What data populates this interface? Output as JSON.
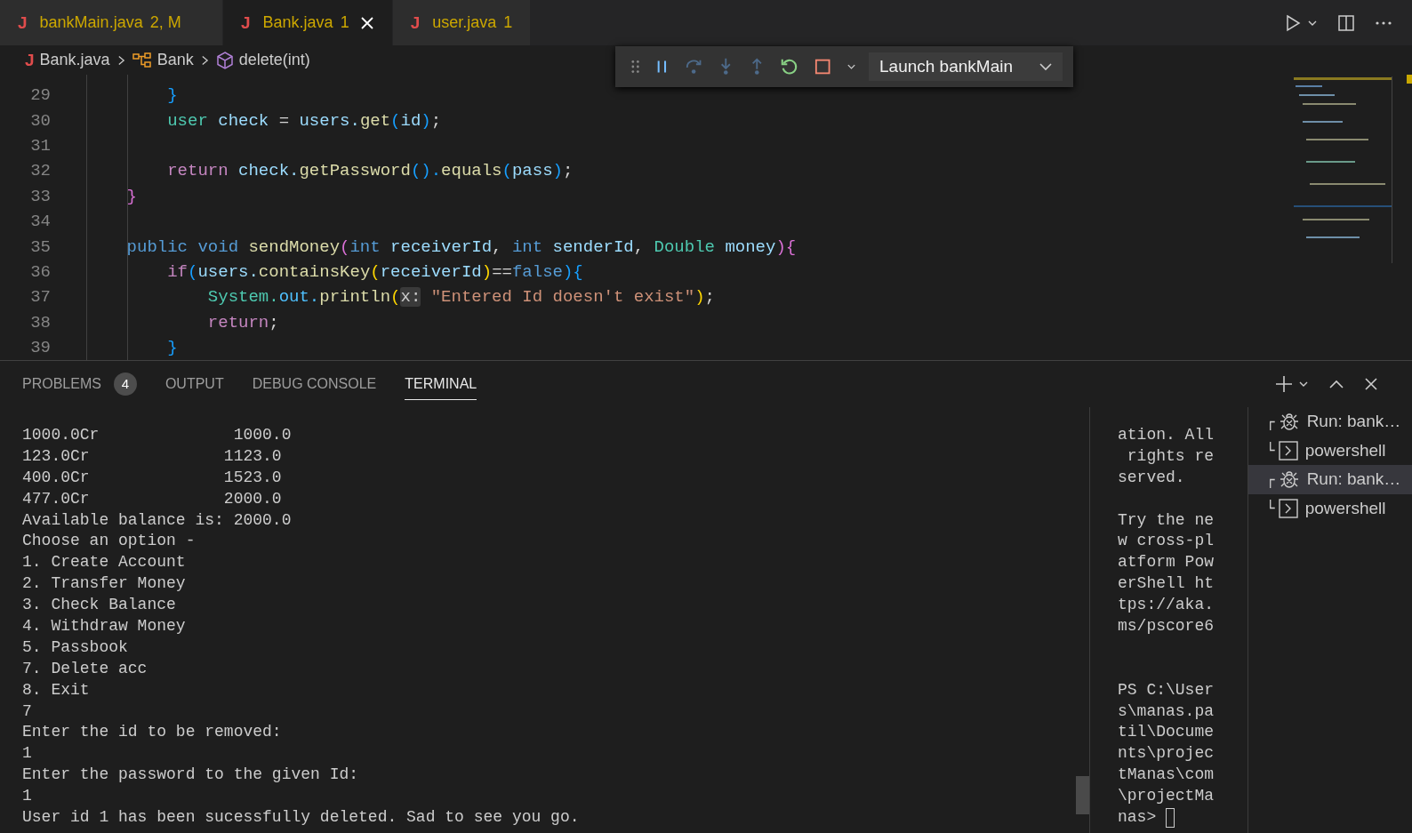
{
  "tabs": [
    {
      "icon": "J",
      "name": "bankMain.java",
      "badge": "2, M",
      "selected": false
    },
    {
      "icon": "J",
      "name": "Bank.java",
      "badge": "1",
      "selected": true
    },
    {
      "icon": "J",
      "name": "user.java",
      "badge": "1",
      "selected": false
    }
  ],
  "breadcrumb": [
    {
      "kind": "file",
      "icon": "J",
      "label": "Bank.java"
    },
    {
      "kind": "class",
      "label": "Bank"
    },
    {
      "kind": "method",
      "label": "delete(int)"
    }
  ],
  "debug_toolbar": {
    "launch_config": "Launch bankMain"
  },
  "code": {
    "lines": [
      {
        "number": "29",
        "tokens": [
          {
            "text": "        }",
            "color": "#179fff"
          }
        ]
      },
      {
        "number": "30",
        "tokens": [
          {
            "text": "        user ",
            "color": "#4ec9b0"
          },
          {
            "text": "check",
            "color": "#9cdcfe"
          },
          {
            "text": " = ",
            "color": "#d4d4d4"
          },
          {
            "text": "users.",
            "color": "#9cdcfe"
          },
          {
            "text": "get",
            "color": "#dcdcaa"
          },
          {
            "text": "(",
            "color": "#179fff"
          },
          {
            "text": "id",
            "color": "#9cdcfe"
          },
          {
            "text": ")",
            "color": "#179fff"
          },
          {
            "text": ";",
            "color": "#d4d4d4"
          }
        ]
      },
      {
        "number": "31"
      },
      {
        "number": "32",
        "tokens": [
          {
            "text": "        return ",
            "color": "#c586c0"
          },
          {
            "text": "check.",
            "color": "#9cdcfe"
          },
          {
            "text": "getPassword",
            "color": "#dcdcaa"
          },
          {
            "text": "().",
            "color": "#179fff"
          },
          {
            "text": "equals",
            "color": "#dcdcaa"
          },
          {
            "text": "(",
            "color": "#179fff"
          },
          {
            "text": "pass",
            "color": "#9cdcfe"
          },
          {
            "text": ")",
            "color": "#179fff"
          },
          {
            "text": ";",
            "color": "#d4d4d4"
          }
        ]
      },
      {
        "number": "33",
        "tokens": [
          {
            "text": "    }",
            "color": "#da70d6"
          }
        ]
      },
      {
        "number": "34"
      },
      {
        "number": "35",
        "tokens": [
          {
            "text": "    public void ",
            "color": "#569cd6"
          },
          {
            "text": "sendMoney",
            "color": "#dcdcaa"
          },
          {
            "text": "(",
            "color": "#da70d6"
          },
          {
            "text": "int ",
            "color": "#569cd6"
          },
          {
            "text": "receiverId",
            "color": "#9cdcfe"
          },
          {
            "text": ", ",
            "color": "#d4d4d4"
          },
          {
            "text": "int ",
            "color": "#569cd6"
          },
          {
            "text": "senderId",
            "color": "#9cdcfe"
          },
          {
            "text": ", ",
            "color": "#d4d4d4"
          },
          {
            "text": "Double ",
            "color": "#4ec9b0"
          },
          {
            "text": "money",
            "color": "#9cdcfe"
          },
          {
            "text": "){",
            "color": "#da70d6"
          }
        ]
      },
      {
        "number": "36",
        "tokens": [
          {
            "text": "        if",
            "color": "#c586c0"
          },
          {
            "text": "(",
            "color": "#179fff"
          },
          {
            "text": "users.",
            "color": "#9cdcfe"
          },
          {
            "text": "containsKey",
            "color": "#dcdcaa"
          },
          {
            "text": "(",
            "color": "#ffd700"
          },
          {
            "text": "receiverId",
            "color": "#9cdcfe"
          },
          {
            "text": ")",
            "color": "#ffd700"
          },
          {
            "text": "==",
            "color": "#d4d4d4"
          },
          {
            "text": "false",
            "color": "#569cd6"
          },
          {
            "text": "){",
            "color": "#179fff"
          }
        ]
      },
      {
        "number": "37",
        "tokens": [
          {
            "text": "            System.",
            "color": "#4ec9b0"
          },
          {
            "text": "out.",
            "color": "#4fc1ff"
          },
          {
            "text": "println",
            "color": "#dcdcaa"
          },
          {
            "text": "(",
            "color": "#ffd700"
          },
          {
            "text": "x:",
            "kind": "hint",
            "color": "#cccccc"
          },
          {
            "text": " \"Entered Id doesn't exist\"",
            "color": "#ce9178"
          },
          {
            "text": ")",
            "color": "#ffd700"
          },
          {
            "text": ";",
            "color": "#d4d4d4"
          }
        ]
      },
      {
        "number": "38",
        "tokens": [
          {
            "text": "            return",
            "color": "#c586c0"
          },
          {
            "text": ";",
            "color": "#d4d4d4"
          }
        ]
      },
      {
        "number": "39",
        "tokens": [
          {
            "text": "        }",
            "color": "#179fff"
          }
        ]
      }
    ]
  },
  "panel": {
    "tabs": [
      {
        "label": "PROBLEMS",
        "count": "4",
        "selected": false
      },
      {
        "label": "OUTPUT",
        "selected": false
      },
      {
        "label": "DEBUG CONSOLE",
        "selected": false
      },
      {
        "label": "TERMINAL",
        "selected": true
      }
    ],
    "terminal_output": [
      "1000.0Cr              1000.0",
      "123.0Cr              1123.0",
      "400.0Cr              1523.0",
      "477.0Cr              2000.0",
      "Available balance is: 2000.0",
      "Choose an option -",
      "1. Create Account",
      "2. Transfer Money",
      "3. Check Balance",
      "4. Withdraw Money",
      "5. Passbook",
      "7. Delete acc",
      "8. Exit",
      "7",
      "Enter the id to be removed:",
      "1",
      "Enter the password to the given Id:",
      "1",
      "User id 1 has been sucessfully deleted. Sad to see you go."
    ],
    "split_output": [
      {
        "kind": "text",
        "text": "ation. All"
      },
      {
        "kind": "text",
        "text": " rights re"
      },
      {
        "kind": "text",
        "text": "served."
      },
      {
        "kind": "blank"
      },
      {
        "kind": "text",
        "text": "Try the ne"
      },
      {
        "kind": "text",
        "text": "w cross-pl"
      },
      {
        "kind": "text",
        "text": "atform Pow"
      },
      {
        "kind": "text",
        "text": "erShell ht"
      },
      {
        "kind": "text",
        "text": "tps://aka."
      },
      {
        "kind": "text",
        "text": "ms/pscore6"
      },
      {
        "kind": "blank"
      },
      {
        "kind": "blank"
      },
      {
        "kind": "text",
        "text": "PS C:\\User"
      },
      {
        "kind": "text",
        "text": "s\\manas.pa"
      },
      {
        "kind": "text",
        "text": "til\\Docume"
      },
      {
        "kind": "text",
        "text": "nts\\projec"
      },
      {
        "kind": "text",
        "text": "tManas\\com"
      },
      {
        "kind": "text",
        "text": "\\projectMa"
      },
      {
        "kind": "prompt",
        "text": "nas> "
      }
    ],
    "terminals": [
      {
        "branch": "┌",
        "kind": "debug",
        "label": "Run: bank…",
        "selected": false
      },
      {
        "branch": "└",
        "kind": "shell",
        "label": "powershell",
        "selected": false
      },
      {
        "branch": "┌",
        "kind": "debug",
        "label": "Run: bank…",
        "selected": true
      },
      {
        "branch": "└",
        "kind": "shell",
        "label": "powershell",
        "selected": false
      }
    ]
  }
}
